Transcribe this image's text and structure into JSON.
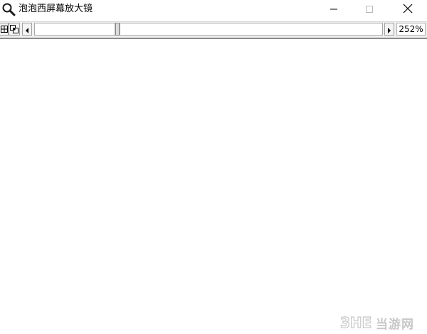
{
  "window": {
    "title": "泡泡西屏幕放大镜",
    "icon": "magnifier-icon",
    "controls": {
      "minimize_icon": "minimize-icon",
      "maximize_icon": "maximize-icon",
      "close_icon": "close-icon"
    }
  },
  "toolbar": {
    "grid_icon": "grid-icon",
    "link_icon": "link-windows-icon",
    "left_arrow_icon": "arrow-left-icon",
    "right_arrow_icon": "arrow-right-icon",
    "zoom_value": "252%"
  },
  "watermark": {
    "logo": "3HE",
    "text": "当游网"
  },
  "colors": {
    "toolbar_bg": "#f0f0f0",
    "content_bg": "#ffffff"
  }
}
